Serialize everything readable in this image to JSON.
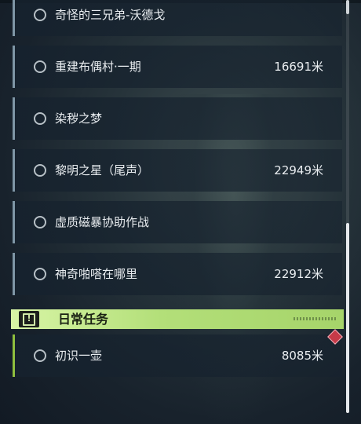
{
  "quests": [
    {
      "name": "奇怪的三兄弟-沃德戈",
      "distance": ""
    },
    {
      "name": "重建布偶村·一期",
      "distance": "16691米"
    },
    {
      "name": "染秽之梦",
      "distance": ""
    },
    {
      "name": "黎明之星（尾声）",
      "distance": "22949米"
    },
    {
      "name": "虚质磁暴协助作战",
      "distance": ""
    },
    {
      "name": "神奇啪嗒在哪里",
      "distance": "22912米"
    }
  ],
  "daily_section": {
    "title": "日常任务",
    "icon": "alert-box-icon",
    "icon_glyph": "!",
    "accent_color": "#b3df79"
  },
  "daily_quests": [
    {
      "name": "初识一壶",
      "distance": "8085米"
    }
  ],
  "alert_marker": {
    "icon": "diamond-alert-icon",
    "color": "#c63a48"
  }
}
